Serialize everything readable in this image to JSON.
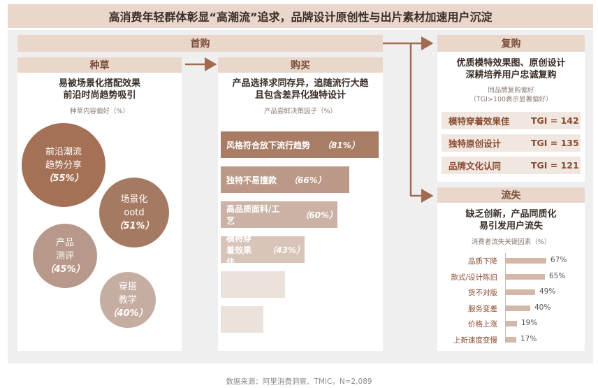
{
  "title": "高消费年轻群体彰显“高潮流”追求，品牌设计原创性与出片素材加速用户沉淀",
  "first_purchase": {
    "label": "首购"
  },
  "seeding": {
    "header": "种草",
    "title_line1": "易被场景化搭配效果",
    "title_line2": "前沿时尚趋势吸引",
    "subtitle": "种草内容偏好（%）",
    "bubbles": [
      {
        "line1": "前沿潮流",
        "line2": "趋势分享",
        "pct": "（55%）",
        "color": "#a47156"
      },
      {
        "line1": "场景化",
        "line2": "ootd",
        "pct": "（51%）",
        "color": "#a67a62"
      },
      {
        "line1": "产品",
        "line2": "测评",
        "pct": "（45%）",
        "color": "#b7988a"
      },
      {
        "line1": "穿搭",
        "line2": "教学",
        "pct": "（40%）",
        "color": "#c6ada1"
      }
    ]
  },
  "purchase": {
    "header": "购买",
    "title_line1": "产品选择求同存异，追随流行大趋",
    "title_line2": "且包含差异化独特设计",
    "subtitle": "产品尝鲜决策因子（%）",
    "bars": [
      {
        "label": "风格符合放下流行趋势",
        "pct": "（81%）",
        "value": 81,
        "color": "#a97c66"
      },
      {
        "label": "独特不易撞款",
        "pct": "（66%）",
        "value": 66,
        "color": "#bb9887"
      },
      {
        "label": "高品质面料/工艺",
        "pct": "（60%）",
        "value": 60,
        "color": "#cbb2a5"
      },
      {
        "label": "模特穿着效果佳",
        "pct": "（43%）",
        "value": 43,
        "color": "#d8c4b9"
      },
      {
        "label": "",
        "pct": "",
        "value": 33,
        "color": "#ece2dc"
      },
      {
        "label": "",
        "pct": "",
        "value": 22,
        "color": "#ece2dc"
      }
    ]
  },
  "repurchase": {
    "header": "复购",
    "title_line1": "优质模特效果图、原创设计",
    "title_line2": "深耕培养用户忠诚复购",
    "subtitle_line1": "同品牌复购偏好",
    "subtitle_line2": "（TGI>100表示显著偏好）",
    "rows": [
      {
        "label": "模特穿着效果佳",
        "tgi": "TGI = 142"
      },
      {
        "label": "独特原创设计",
        "tgi": "TGI = 135"
      },
      {
        "label": "品牌文化认同",
        "tgi": "TGI = 121"
      }
    ]
  },
  "churn": {
    "header": "流失",
    "title_line1": "缺乏创新，产品同质化",
    "title_line2": "易引发用户流失",
    "subtitle": "消费者流失关键因素（%）",
    "items": [
      {
        "label": "品质下降",
        "value": 67,
        "display": "67%"
      },
      {
        "label": "款式/设计陈旧",
        "value": 65,
        "display": "65%"
      },
      {
        "label": "货不对版",
        "value": 49,
        "display": "49%"
      },
      {
        "label": "服务变差",
        "value": 40,
        "display": "40%"
      },
      {
        "label": "价格上涨",
        "value": 19,
        "display": "19%"
      },
      {
        "label": "上新速度变慢",
        "value": 17,
        "display": "17%"
      }
    ]
  },
  "footer": "数据来源：阿里消费洞察、TMIC，N=2,089",
  "colors": {
    "accent": "#a46a4f",
    "header_bg": "#ead7cc",
    "panel_bg": "#f0efef"
  }
}
